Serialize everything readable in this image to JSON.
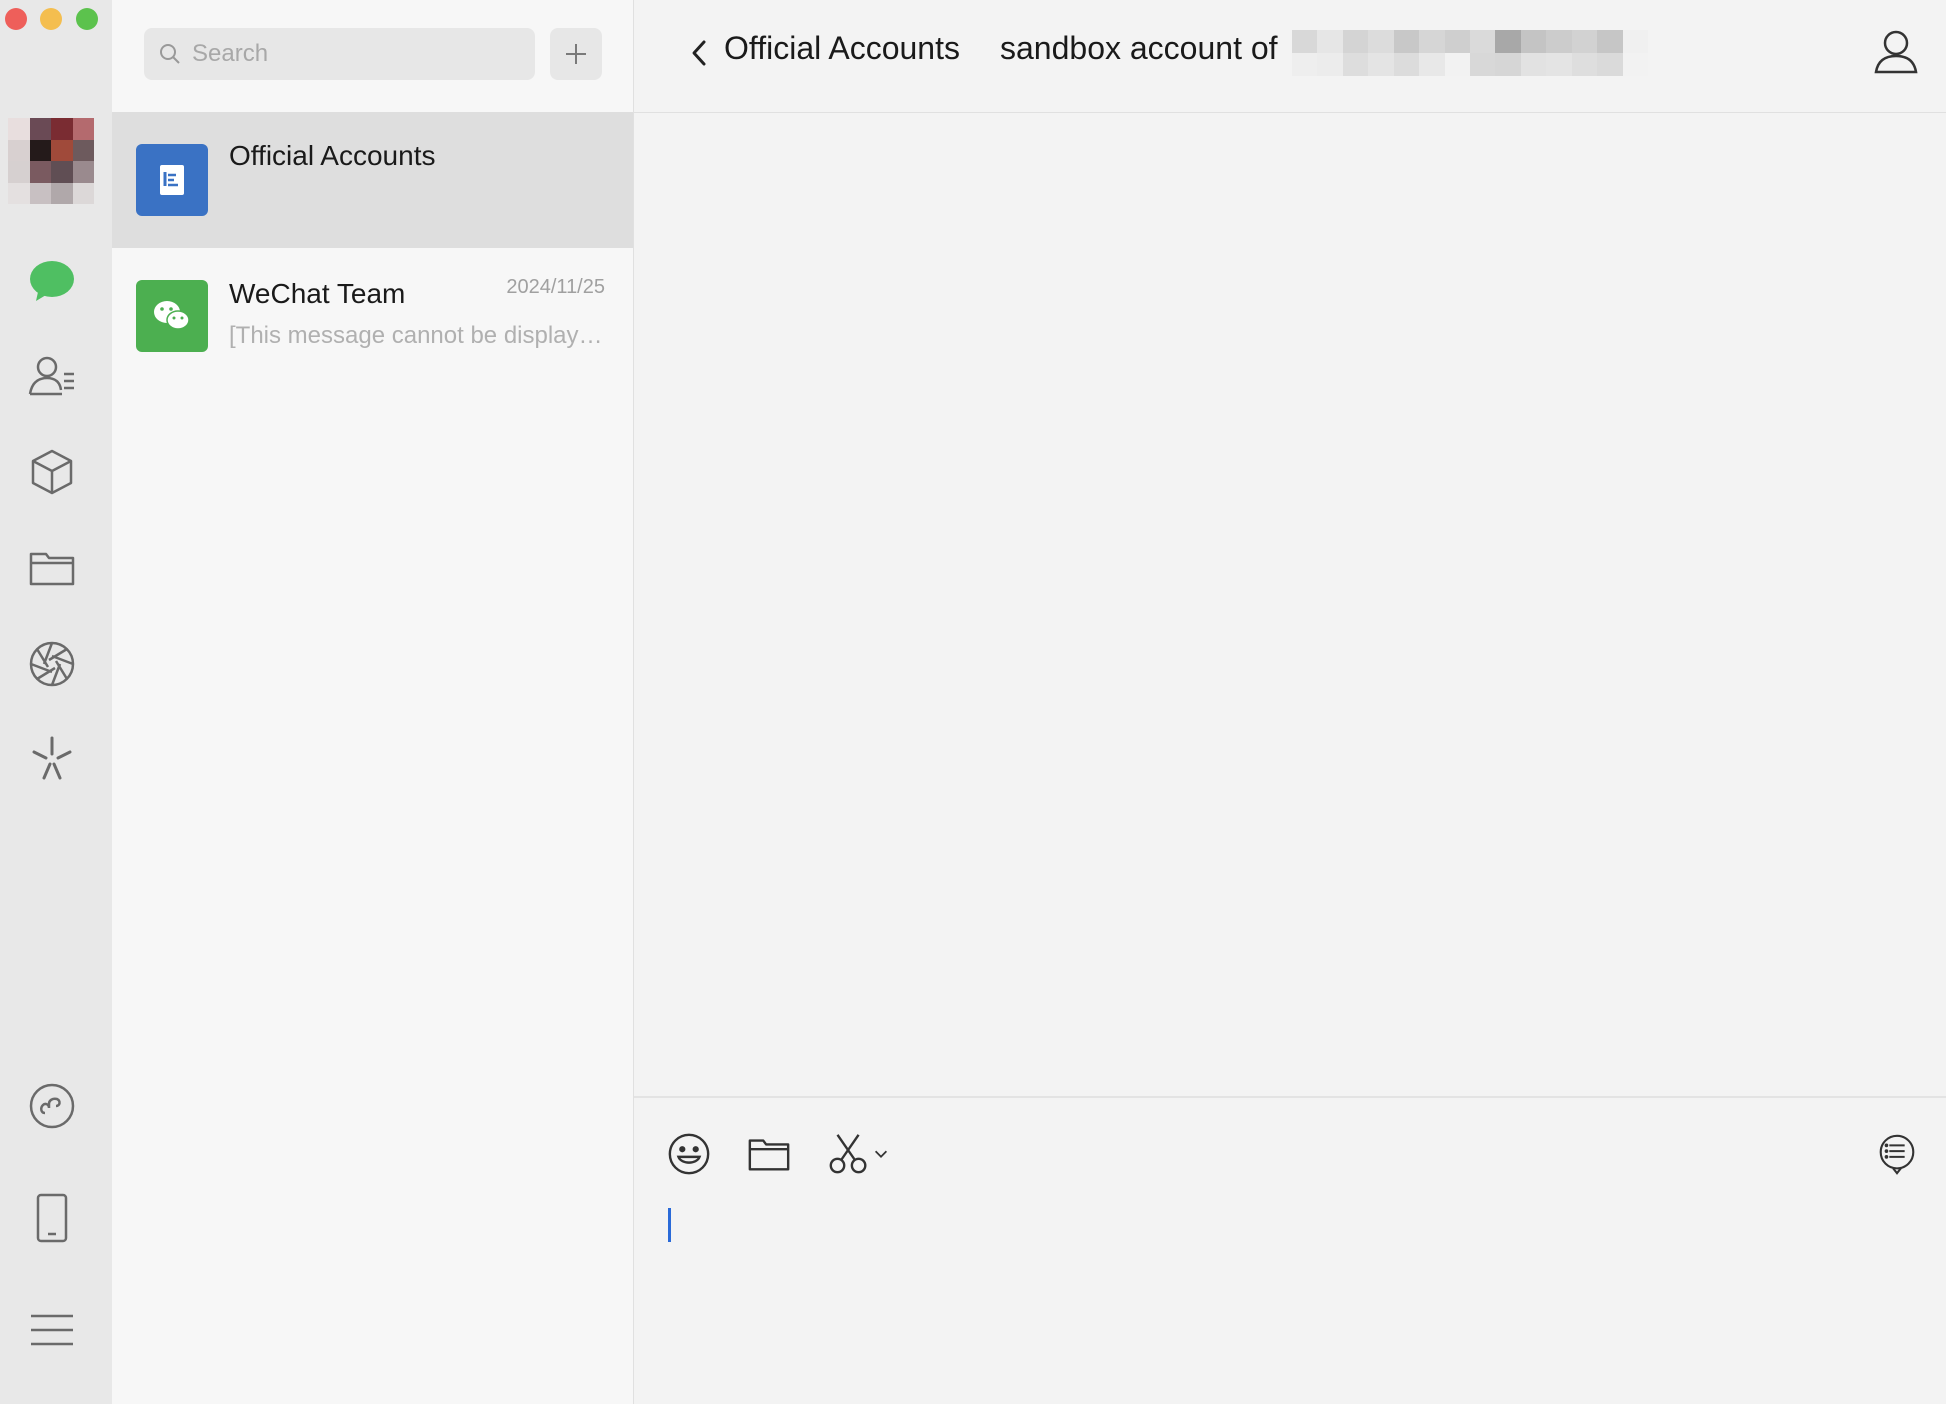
{
  "window": {
    "controls": [
      "close",
      "minimize",
      "zoom"
    ]
  },
  "sidebar": {
    "items": [
      {
        "name": "chats",
        "icon": "chat-bubble-icon",
        "active": true,
        "accent": "#4fbf62"
      },
      {
        "name": "contacts",
        "icon": "contacts-icon"
      },
      {
        "name": "favorites",
        "icon": "cube-icon"
      },
      {
        "name": "files",
        "icon": "folder-icon"
      },
      {
        "name": "moments",
        "icon": "shutter-icon"
      },
      {
        "name": "search",
        "icon": "sparkle-icon"
      },
      {
        "name": "mini-programs",
        "icon": "mini-program-icon"
      },
      {
        "name": "phone",
        "icon": "phone-icon"
      },
      {
        "name": "more",
        "icon": "menu-icon"
      }
    ]
  },
  "search": {
    "placeholder": "Search",
    "icon": "search-icon",
    "add_icon": "plus-icon"
  },
  "chat_list": [
    {
      "name": "Official Accounts",
      "date": "",
      "preview": "",
      "selected": true,
      "icon": "official-accounts-icon",
      "color": "#3a72c4"
    },
    {
      "name": "WeChat Team",
      "date": "2024/11/25",
      "preview": "[This message cannot be displayed]",
      "selected": false,
      "icon": "wechat-logo-icon",
      "color": "#4caf50"
    }
  ],
  "chat": {
    "breadcrumb": "Official Accounts",
    "title": "sandbox account of",
    "toolbar": [
      "emoji-icon",
      "folder-icon",
      "scissors-icon",
      "chat-history-icon"
    ],
    "cursor_color": "#2a6ad8"
  }
}
